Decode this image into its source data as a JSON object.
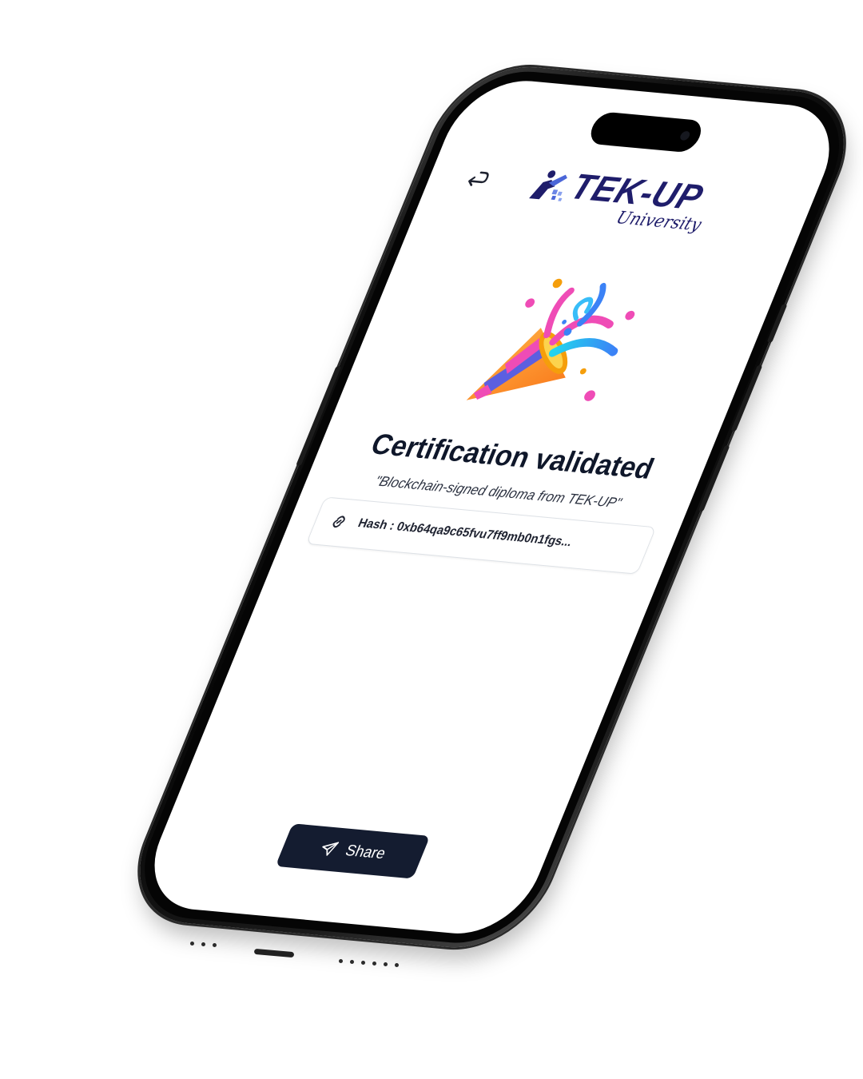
{
  "brand": {
    "name": "TEK-UP",
    "subtitle": "University",
    "color": "#1f1d6b"
  },
  "screen": {
    "title": "Certification validated",
    "subtitle": "\"Blockchain-signed diploma from TEK-UP\"",
    "hash_text": "Hash : 0xb64qa9c65fvu7ff9mb0n1fgs...",
    "share_label": "Share"
  },
  "icons": {
    "back": "return-arrow-icon",
    "hash": "link-icon",
    "share": "send-icon",
    "celebration": "party-popper-icon"
  },
  "colors": {
    "button_bg": "#141c30",
    "text_primary": "#0f172a",
    "border": "#dde1e6"
  }
}
